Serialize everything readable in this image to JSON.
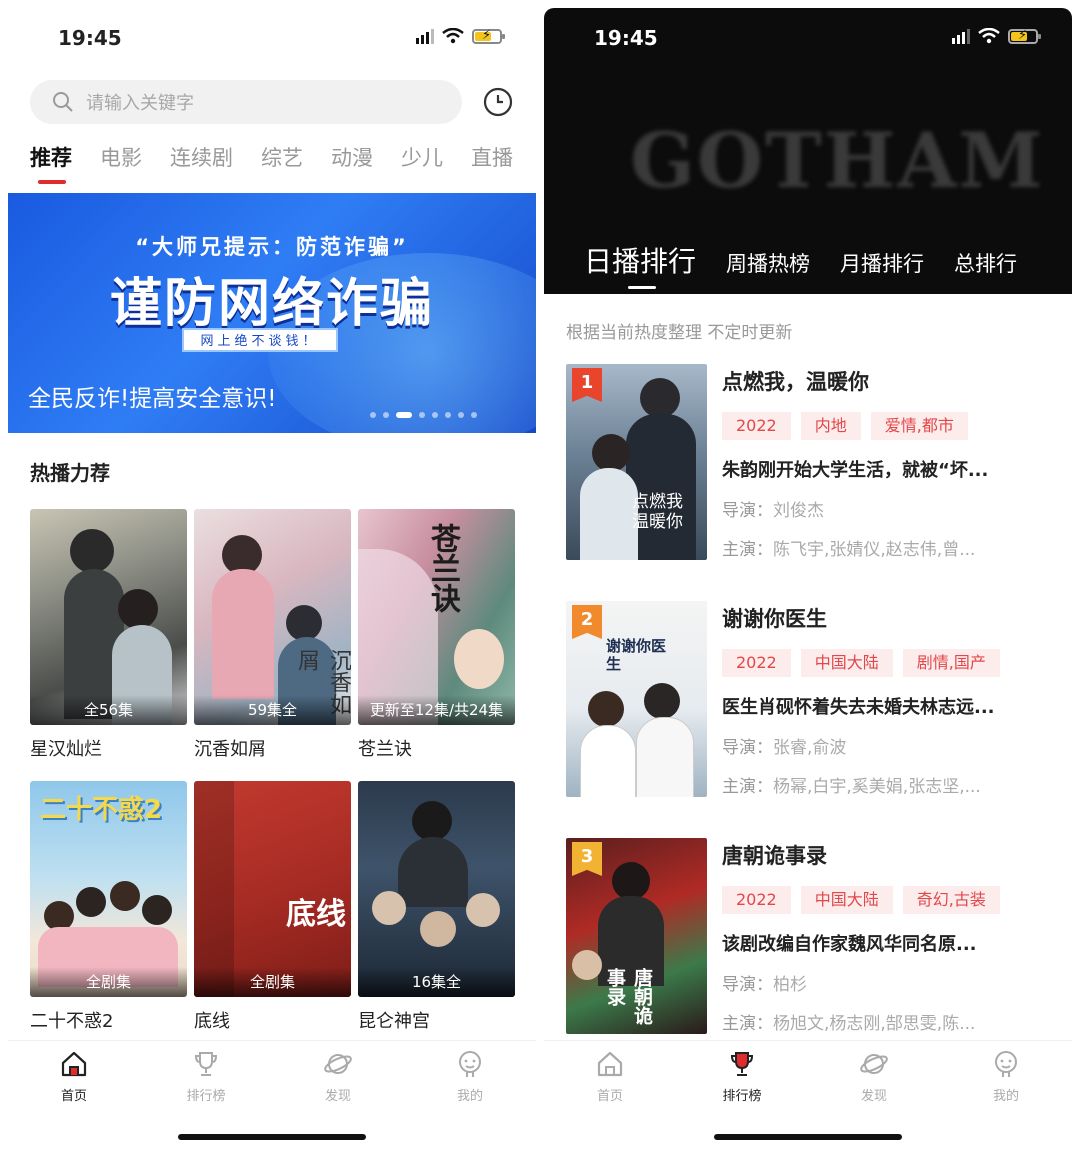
{
  "left": {
    "status": {
      "time": "19:45"
    },
    "search": {
      "placeholder": "请输入关键字"
    },
    "tabs": [
      "推荐",
      "电影",
      "连续剧",
      "综艺",
      "动漫",
      "少儿",
      "直播"
    ],
    "banner": {
      "line1": "“大师兄提示：防范诈骗”",
      "title": "谨防网络诈骗",
      "box": "网上绝不谈钱！",
      "slogan": "全民反诈!提高安全意识!"
    },
    "section_title": "热播力荐",
    "cards": [
      {
        "name": "星汉灿烂",
        "tag": "全56集"
      },
      {
        "name": "沉香如屑",
        "tag": "59集全"
      },
      {
        "name": "苍兰诀",
        "tag": "更新至12集/共24集"
      },
      {
        "name": "二十不惑2",
        "tag": "全剧集"
      },
      {
        "name": "底线",
        "tag": "全剧集"
      },
      {
        "name": "昆仑神宫",
        "tag": "16集全"
      }
    ],
    "poster_text": {
      "c2": "沉香如屑",
      "c3": "苍兰诀",
      "c4": "二十不惑2",
      "c5": "底线"
    },
    "nav": [
      "首页",
      "排行榜",
      "发现",
      "我的"
    ]
  },
  "right": {
    "status": {
      "time": "19:45"
    },
    "hero_text": "GOTHAM",
    "rank_tabs": [
      "日播排行",
      "周播热榜",
      "月播排行",
      "总排行"
    ],
    "note": "根据当前热度整理 不定时更新",
    "items": [
      {
        "rank": "1",
        "title": "点燃我，温暖你",
        "chips": [
          "2022",
          "内地",
          "爱情,都市"
        ],
        "desc": "朱韵刚开始大学生活，就被“坏...",
        "director_label": "导演：",
        "director": "刘俊杰",
        "cast_label": "主演：",
        "cast": "陈飞宇,张婧仪,赵志伟,曾...",
        "poster_text": "点燃我温暖你"
      },
      {
        "rank": "2",
        "title": "谢谢你医生",
        "chips": [
          "2022",
          "中国大陆",
          "剧情,国产"
        ],
        "desc": "医生肖砚怀着失去未婚夫林志远...",
        "director_label": "导演：",
        "director": "张睿,俞波",
        "cast_label": "主演：",
        "cast": "杨幂,白宇,奚美娟,张志坚,...",
        "poster_text": "谢谢你医生"
      },
      {
        "rank": "3",
        "title": "唐朝诡事录",
        "chips": [
          "2022",
          "中国大陆",
          "奇幻,古装"
        ],
        "desc": "该剧改编自作家魏风华同名原...",
        "director_label": "导演：",
        "director": "柏杉",
        "cast_label": "主演：",
        "cast": "杨旭文,杨志刚,郜思雯,陈...",
        "poster_text": "唐朝诡事录"
      }
    ],
    "nav": [
      "首页",
      "排行榜",
      "发现",
      "我的"
    ]
  },
  "colors": {
    "accent": "#e02c2c",
    "chip_bg": "#fdecec",
    "chip_text": "#e2474a"
  }
}
